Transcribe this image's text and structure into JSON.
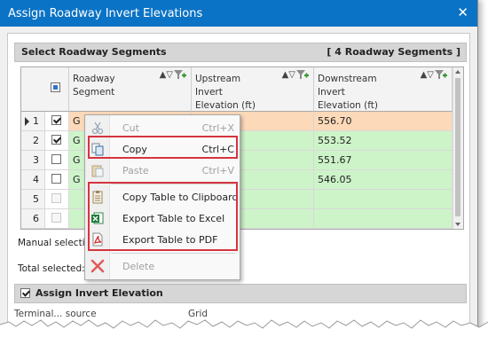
{
  "window": {
    "title": "Assign Roadway Invert Elevations",
    "close_glyph": "✕"
  },
  "segments": {
    "header_label": "Select Roadway Segments",
    "header_count": "[ 4 Roadway Segments ]",
    "columns": [
      {
        "label": "Roadway\nSegment"
      },
      {
        "label": "Upstream\nInvert\nElevation (ft)"
      },
      {
        "label": "Downstream\nInvert\nElevation (ft)"
      }
    ],
    "sort_glyph": "▲▽",
    "rows": [
      {
        "num": "1",
        "checked": true,
        "segment": "G",
        "upstream": "",
        "downstream": "556.70",
        "bg": "#fcd9b8",
        "current": true
      },
      {
        "num": "2",
        "checked": true,
        "segment": "G",
        "upstream": "",
        "downstream": "553.52",
        "bg": "#cdf4c9",
        "current": false
      },
      {
        "num": "3",
        "checked": false,
        "segment": "G",
        "upstream": "",
        "downstream": "551.67",
        "bg": "#cdf4c9",
        "current": false
      },
      {
        "num": "4",
        "checked": false,
        "segment": "G",
        "upstream": "",
        "downstream": "546.05",
        "bg": "#cdf4c9",
        "current": false
      },
      {
        "num": "5",
        "checked": false,
        "segment": "",
        "upstream": "",
        "downstream": "",
        "bg": "#cdf4c9",
        "current": false,
        "disabled": true
      },
      {
        "num": "6",
        "checked": false,
        "segment": "",
        "upstream": "",
        "downstream": "",
        "bg": "#cdf4c9",
        "current": false,
        "disabled": true
      }
    ],
    "manual_selection_label": "Manual selection",
    "total_selected_label": "Total selected:"
  },
  "assign": {
    "label": "Assign Invert Elevation",
    "checked": true
  },
  "bottom_fragment": {
    "left": "Terminal... source",
    "right": "Grid"
  },
  "context_menu": {
    "items": [
      {
        "label": "Cut",
        "shortcut": "Ctrl+X",
        "disabled": true,
        "icon": "scissors-icon"
      },
      {
        "label": "Copy",
        "shortcut": "Ctrl+C",
        "disabled": false,
        "icon": "copy-icon"
      },
      {
        "label": "Paste",
        "shortcut": "Ctrl+V",
        "disabled": true,
        "icon": "paste-icon"
      },
      {
        "label": "Copy Table to Clipboard",
        "shortcut": "",
        "disabled": false,
        "icon": "clipboard-icon"
      },
      {
        "label": "Export Table to Excel",
        "shortcut": "",
        "disabled": false,
        "icon": "excel-icon"
      },
      {
        "label": "Export Table to PDF",
        "shortcut": "",
        "disabled": false,
        "icon": "pdf-icon"
      },
      {
        "label": "Delete",
        "shortcut": "",
        "disabled": true,
        "icon": "delete-x-icon"
      }
    ]
  },
  "colors": {
    "titlebar": "#0b73c5",
    "highlight_border": "#d6343f",
    "row_selected": "#fcd9b8",
    "row_normal": "#cdf4c9"
  }
}
